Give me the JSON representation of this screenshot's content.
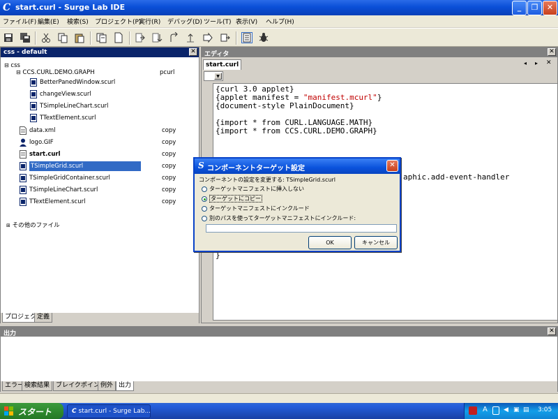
{
  "window": {
    "title": "start.curl - Surge Lab IDE",
    "min_label": "_",
    "max_label": "❐",
    "close_label": "✕"
  },
  "menubar": [
    "ファイル(F)",
    "編集(E)",
    "検索(S)",
    "プロジェクト(P)",
    "実行(R)",
    "デバッグ(D)",
    "ツール(T)",
    "表示(V)",
    "ヘルプ(H)"
  ],
  "toolbar": {
    "icons": [
      "save-icon",
      "save-all-icon",
      "cut-icon",
      "copy-icon",
      "paste-icon",
      "project-icon",
      "file-icon",
      "step-into-icon",
      "step-over-icon",
      "step-out-icon",
      "step-return-icon",
      "run-icon",
      "document-icon",
      "debug-bug-icon"
    ]
  },
  "project_panel": {
    "title": "css - default",
    "close": "✕",
    "tree": [
      {
        "label": "css",
        "indent": 0,
        "tag": ""
      },
      {
        "label": "CCS.CURL.DEMO.GRAPH",
        "indent": 1,
        "tag": "pcurl"
      },
      {
        "label": "BetterPanedWindow.scurl",
        "indent": 2,
        "tag": ""
      },
      {
        "label": "changeView.scurl",
        "indent": 2,
        "tag": ""
      },
      {
        "label": "TSimpleLineChart.scurl",
        "indent": 2,
        "tag": ""
      },
      {
        "label": "TTextElement.scurl",
        "indent": 2,
        "tag": ""
      },
      {
        "label": "data.xml",
        "indent": 1,
        "tag": "copy"
      },
      {
        "label": "logo.GIF",
        "indent": 1,
        "tag": "copy"
      },
      {
        "label": "start.curl",
        "indent": 1,
        "tag": "copy"
      },
      {
        "label": "TSimpleGrid.scurl",
        "indent": 1,
        "tag": "copy"
      },
      {
        "label": "TSimpleGridContainer.scurl",
        "indent": 1,
        "tag": "copy"
      },
      {
        "label": "TSimpleLineChart.scurl",
        "indent": 1,
        "tag": "copy"
      },
      {
        "label": "TTextElement.scurl",
        "indent": 1,
        "tag": "copy"
      }
    ],
    "other_files": "その他のファイル",
    "tabs": [
      "プロジェクト",
      "定義"
    ]
  },
  "editor": {
    "title": "エディタ",
    "tab": "start.curl",
    "code": [
      "{curl 3.0 applet}",
      "{applet manifest = \"manifest.mcurl\"}",
      "{document-style PlainDocument}",
      "",
      "{import * from CURL.LANGUAGE.MATH}",
      "{import * from CCS.CURL.DEMO.GRAPH}"
    ],
    "partial_line": "aphic.add-event-handler",
    "closing_brace": "}"
  },
  "output_panel": {
    "title": "出力",
    "tabs": [
      "エラー",
      "検索結果",
      "ブレイクポイント",
      "例外",
      "出力"
    ]
  },
  "dialog": {
    "title": "コンポーネントターゲット設定",
    "message": "コンポーネントの設定を変更する: TSimpleGrid.scurl",
    "options": [
      "ターゲットマニフェストに挿入しない",
      "ターゲットにコピー",
      "ターゲットマニフェストにインクルード",
      "別のパスを使ってターゲットマニフェストにインクルード:"
    ],
    "selected_option": 1,
    "path_value": "",
    "ok": "OK",
    "cancel": "キャンセル"
  },
  "taskbar": {
    "start": "スタート",
    "task": "start.curl - Surge Lab...",
    "clock": "3:05"
  },
  "colors": {
    "title_blue": "#0a4fd8",
    "panel_active": "#0a246a",
    "string_red": "#c00000",
    "selection": "#316ac5"
  }
}
